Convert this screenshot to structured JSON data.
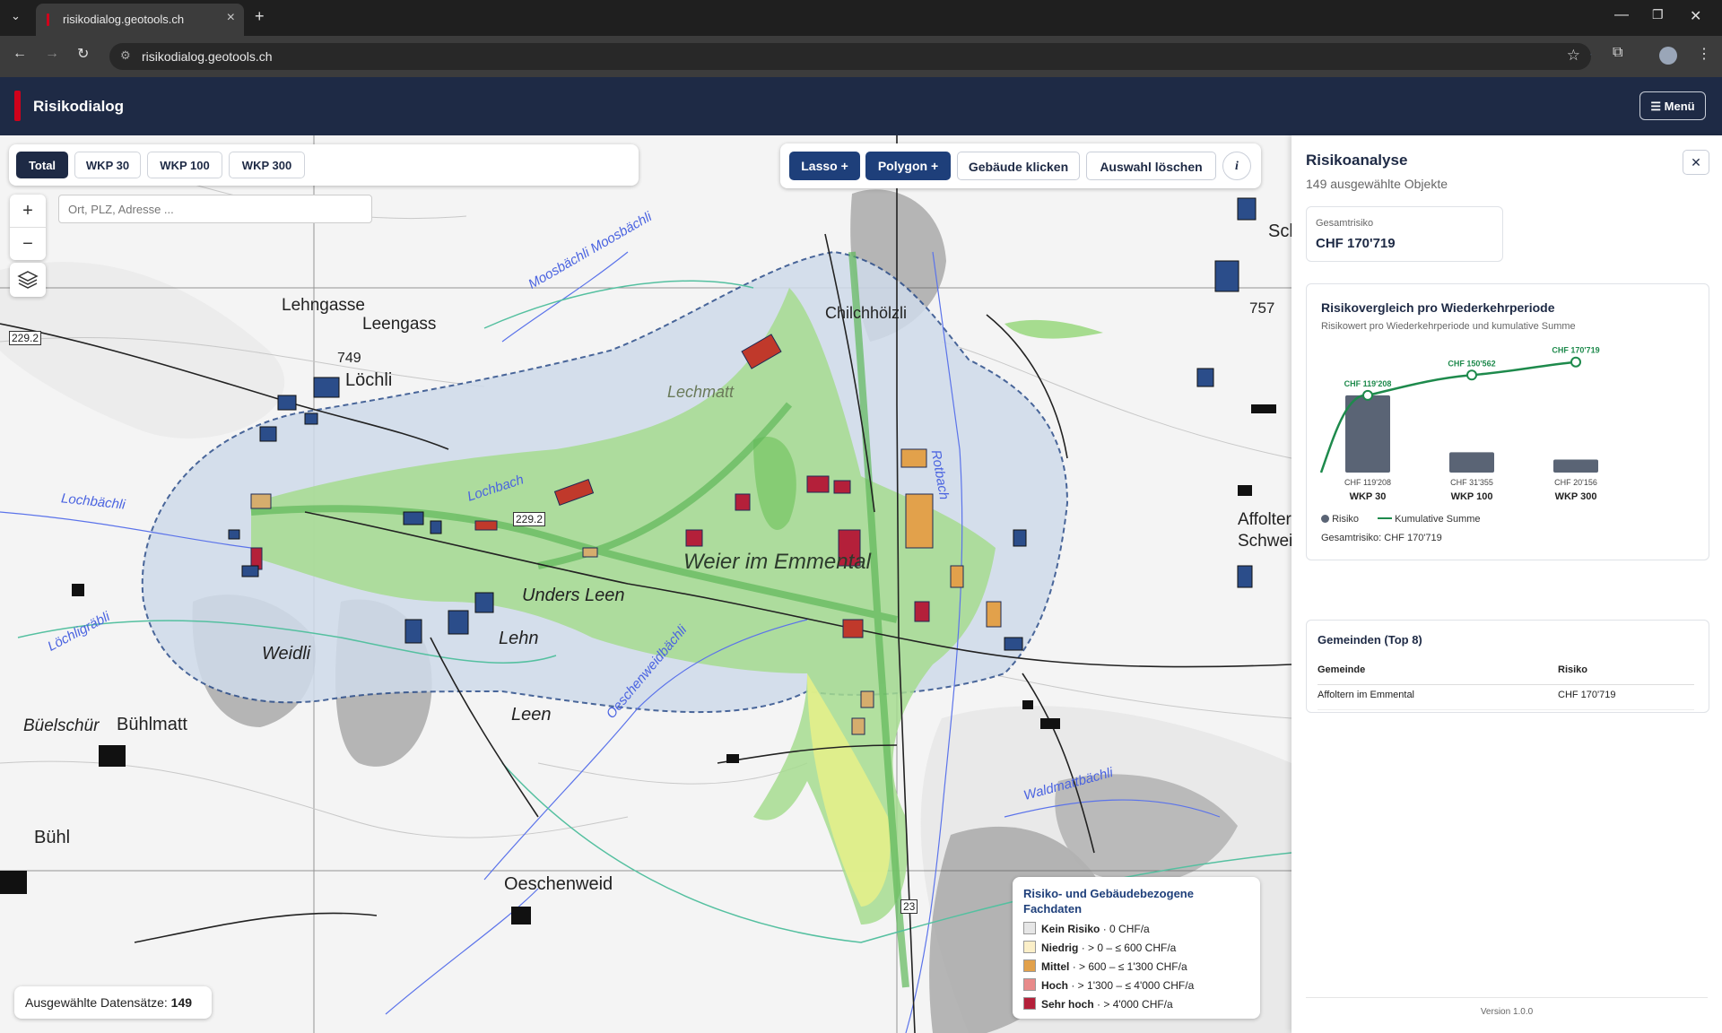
{
  "browser": {
    "tab_title": "risikodialog.geotools.ch",
    "url": "risikodialog.geotools.ch"
  },
  "app": {
    "name": "Risikodialog",
    "menu_label": "☰ Menü",
    "brand_color": "#d0021b",
    "header_color": "#1e2a45"
  },
  "map": {
    "wkp_buttons": [
      "Total",
      "WKP 30",
      "WKP 100",
      "WKP 300"
    ],
    "active_wkp": "Total",
    "search_placeholder": "Ort, PLZ, Adresse ...",
    "tools": {
      "lasso": "Lasso +",
      "polygon": "Polygon +",
      "click_buildings": "Gebäude klicken",
      "clear_selection": "Auswahl löschen",
      "info": "i"
    },
    "zoom_in": "+",
    "zoom_out": "−",
    "selected_label": "Ausgewählte Datensätze:",
    "selected_count": "149",
    "place_labels": {
      "lehngasse": "Lehngasse",
      "leengass": "Leengass",
      "loechli": "Löchli",
      "height_749": "749",
      "chilchhoelzli": "Chilchhölzli",
      "lechmatt": "Lechmatt",
      "unders_leen": "Unders Leen",
      "weier": "Weier im Emmental",
      "lehn": "Lehn",
      "weidli": "Weidli",
      "leen": "Leen",
      "buelschuer": "Büelschür",
      "buehlmatt": "Bühlmatt",
      "buehl": "Bühl",
      "oeschenweid": "Oeschenweid",
      "height_757": "757",
      "affoltern": "Affoltern",
      "schwei": "Schwei",
      "sch": "Sch",
      "road_229": "229.2",
      "road_229b": "229.2",
      "road_23": "23"
    },
    "water_labels": {
      "moosbaechli": "Moosbächli Moosbächli",
      "lochbach": "Lochbach",
      "lochbaechli": "Lochbächli",
      "lochligrabli": "Löchligräbli",
      "rotbach": "Rotbach",
      "oeschenweidbaechli": "Oeschenweidbächli",
      "waldmattbaechli": "Waldmattbächli"
    },
    "legend": {
      "title": "Risiko- und Gebäudebezogene Fachdaten",
      "items": [
        {
          "name": "Kein Risiko",
          "range": "· 0 CHF/a",
          "color": "#e6e6e6"
        },
        {
          "name": "Niedrig",
          "range": "· > 0 – ≤ 600 CHF/a",
          "color": "#fbefc8"
        },
        {
          "name": "Mittel",
          "range": "· > 600 – ≤ 1'300 CHF/a",
          "color": "#e2a14b"
        },
        {
          "name": "Hoch",
          "range": "· > 1'300 – ≤ 4'000 CHF/a",
          "color": "#e88a8a"
        },
        {
          "name": "Sehr hoch",
          "range": "· > 4'000 CHF/a",
          "color": "#b4203a"
        }
      ]
    }
  },
  "sidebar": {
    "title": "Risikoanalyse",
    "subtitle": "149 ausgewählte Objekte",
    "close": "✕",
    "total_label": "Gesamtrisiko",
    "total_value": "CHF 170'719",
    "chart_title": "Risikovergleich pro Wiederkehrperiode",
    "chart_subtitle": "Risikowert pro Wiederkehrperiode und kumulative Summe",
    "legend_risk": "Risiko",
    "legend_cum": "Kumulative Summe",
    "chart_total": "Gesamtrisiko: CHF 170'719",
    "municipalities_title": "Gemeinden (Top 8)",
    "table_headers": [
      "Gemeinde",
      "Risiko"
    ],
    "table_rows": [
      [
        "Affoltern im Emmental",
        "CHF 170'719"
      ]
    ],
    "version": "Version 1.0.0"
  },
  "chart_data": {
    "type": "bar",
    "categories": [
      "WKP 30",
      "WKP 100",
      "WKP 300"
    ],
    "series": [
      {
        "name": "Risiko",
        "values": [
          119208,
          31355,
          20156
        ],
        "labels": [
          "CHF 119'208",
          "CHF 31'355",
          "CHF 20'156"
        ],
        "color": "#5a6475"
      },
      {
        "name": "Kumulative Summe",
        "values": [
          119208,
          150562,
          170719
        ],
        "labels": [
          "CHF 119'208",
          "CHF 150'562",
          "CHF 170'719"
        ],
        "color": "#1e8a4c"
      }
    ],
    "legend": "bottom-left"
  }
}
